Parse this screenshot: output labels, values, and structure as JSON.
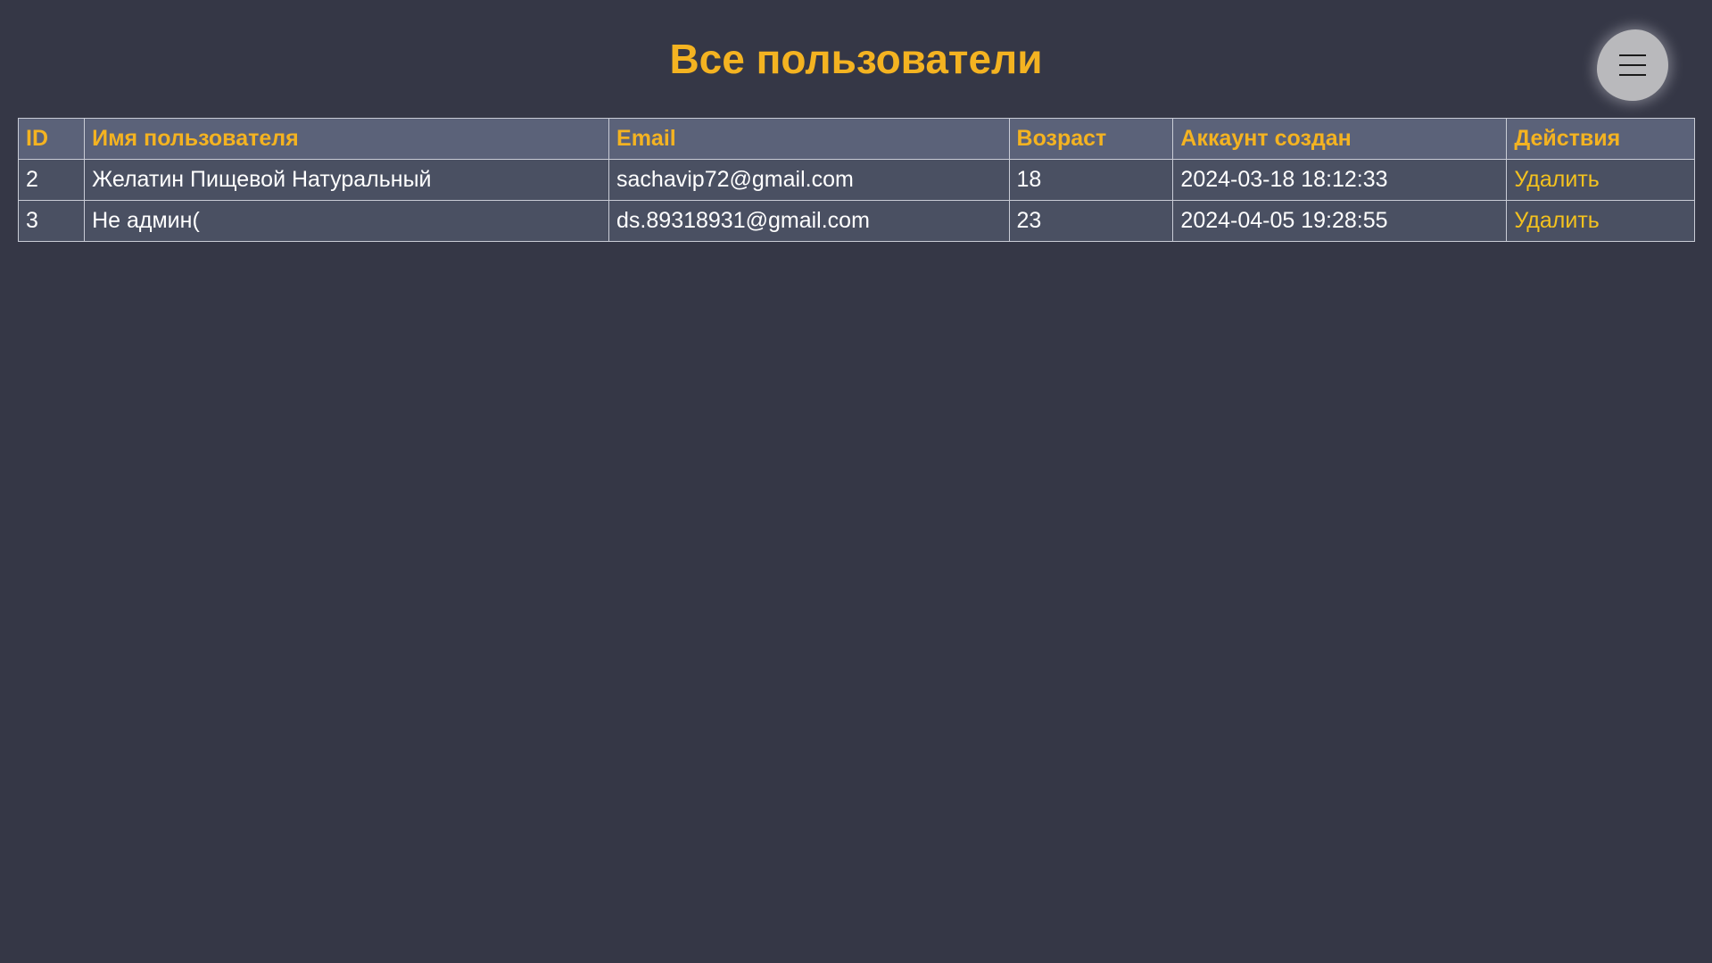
{
  "header": {
    "title": "Все пользователи"
  },
  "menu_button": {
    "icon": "hamburger-menu-icon"
  },
  "table": {
    "columns": [
      "ID",
      "Имя пользователя",
      "Email",
      "Возраст",
      "Аккаунт создан",
      "Действия"
    ],
    "rows": [
      {
        "id": "2",
        "name": "Желатин Пищевой Натуральный",
        "email": "sachavip72@gmail.com",
        "age": "18",
        "created": "2024-03-18 18:12:33",
        "action": "Удалить"
      },
      {
        "id": "3",
        "name": "Не админ(",
        "email": "ds.89318931@gmail.com",
        "age": "23",
        "created": "2024-04-05 19:28:55",
        "action": "Удалить"
      }
    ]
  },
  "colors": {
    "background": "#353746",
    "accent": "#f4b321",
    "header_row": "#5b6279",
    "body_row": "#4a5062",
    "menu_button": "#b9b9bc"
  }
}
